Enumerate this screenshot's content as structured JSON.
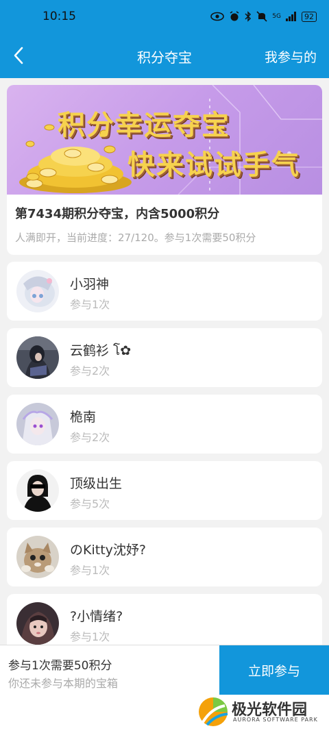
{
  "status_bar": {
    "time": "10:15",
    "network": "5G",
    "battery": "92"
  },
  "header": {
    "title": "积分夺宝",
    "right_action": "我参与的"
  },
  "banner": {
    "line1": "积分幸运夺宝",
    "line2": "快来试试手气"
  },
  "prize": {
    "title": "第7434期积分夺宝，内含5000积分",
    "progress_text": "人满即开，当前进度：27/120。参与1次需要50积分",
    "progress_current": 27,
    "progress_total": 120
  },
  "participants": [
    {
      "name": "小羽神",
      "count": "参与1次"
    },
    {
      "name": "云鹤衫 โ✿",
      "count": "参与2次"
    },
    {
      "name": "桅南",
      "count": "参与2次"
    },
    {
      "name": "顶级出生",
      "count": "参与5次"
    },
    {
      "name": "のKitty沈妤?",
      "count": "参与1次"
    },
    {
      "name": "?小情绪?",
      "count": "参与1次"
    }
  ],
  "footer": {
    "cost_text": "参与1次需要50积分",
    "status_text": "你还未参与本期的宝箱",
    "join_label": "立即参与"
  },
  "watermark": {
    "name": "极光软件园",
    "sub": "AURORA SOFTWARE PARK"
  },
  "colors": {
    "primary": "#1296db",
    "background": "#f2f2f2"
  }
}
